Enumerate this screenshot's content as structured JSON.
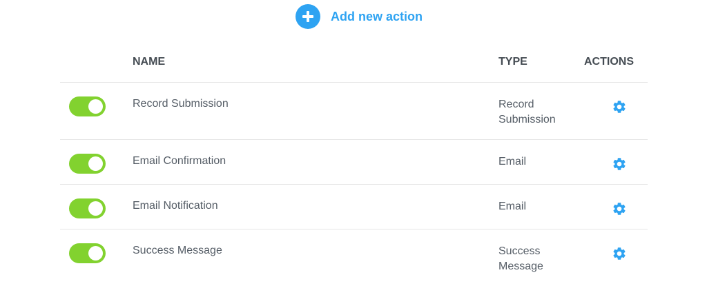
{
  "add_action": {
    "label": "Add new action",
    "icon": "plus-icon"
  },
  "table": {
    "headers": {
      "name": "NAME",
      "type": "TYPE",
      "actions": "ACTIONS"
    },
    "rows": [
      {
        "enabled": true,
        "name": "Record Submission",
        "type": "Record Submission"
      },
      {
        "enabled": true,
        "name": "Email Confirmation",
        "type": "Email"
      },
      {
        "enabled": true,
        "name": "Email Notification",
        "type": "Email"
      },
      {
        "enabled": true,
        "name": "Success Message",
        "type": "Success Message"
      }
    ]
  },
  "colors": {
    "accent": "#2ea3f2",
    "toggle_on": "#82d22f"
  },
  "icons": {
    "settings": "gear-icon"
  }
}
